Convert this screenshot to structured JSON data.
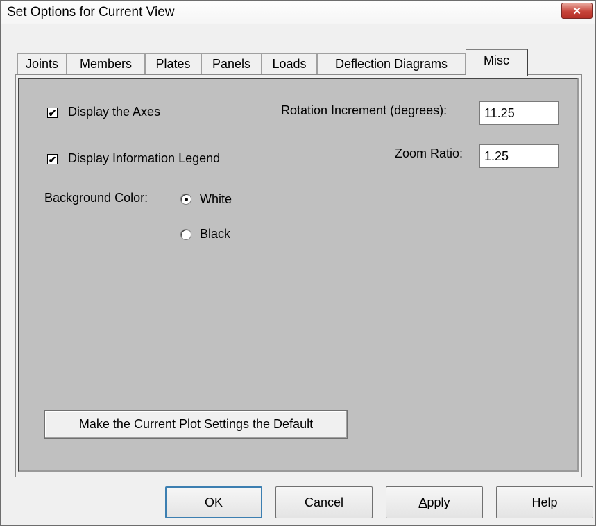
{
  "window": {
    "title": "Set Options for Current View",
    "close_label": "✕"
  },
  "tabs": [
    {
      "label": "Joints"
    },
    {
      "label": "Members"
    },
    {
      "label": "Plates"
    },
    {
      "label": "Panels"
    },
    {
      "label": "Loads"
    },
    {
      "label": "Deflection Diagrams"
    },
    {
      "label": "Misc",
      "active": true
    }
  ],
  "misc": {
    "display_axes": {
      "label": "Display the Axes",
      "checked": true
    },
    "display_legend": {
      "label": "Display Information Legend",
      "checked": true
    },
    "background_color": {
      "label": "Background Color:",
      "options": [
        {
          "label": "White",
          "selected": true
        },
        {
          "label": "Black",
          "selected": false
        }
      ]
    },
    "rotation_increment": {
      "label": "Rotation Increment (degrees):",
      "value": "11.25"
    },
    "zoom_ratio": {
      "label": "Zoom Ratio:",
      "value": "1.25"
    },
    "default_button": "Make the Current Plot Settings the Default"
  },
  "buttons": {
    "ok": "OK",
    "cancel": "Cancel",
    "apply_first": "A",
    "apply_rest": "pply",
    "help": "Help"
  },
  "colors": {
    "panel_bg": "#c0c0c0",
    "label_blue": "#0000ff",
    "dialog_bg": "#f0f0f0"
  }
}
